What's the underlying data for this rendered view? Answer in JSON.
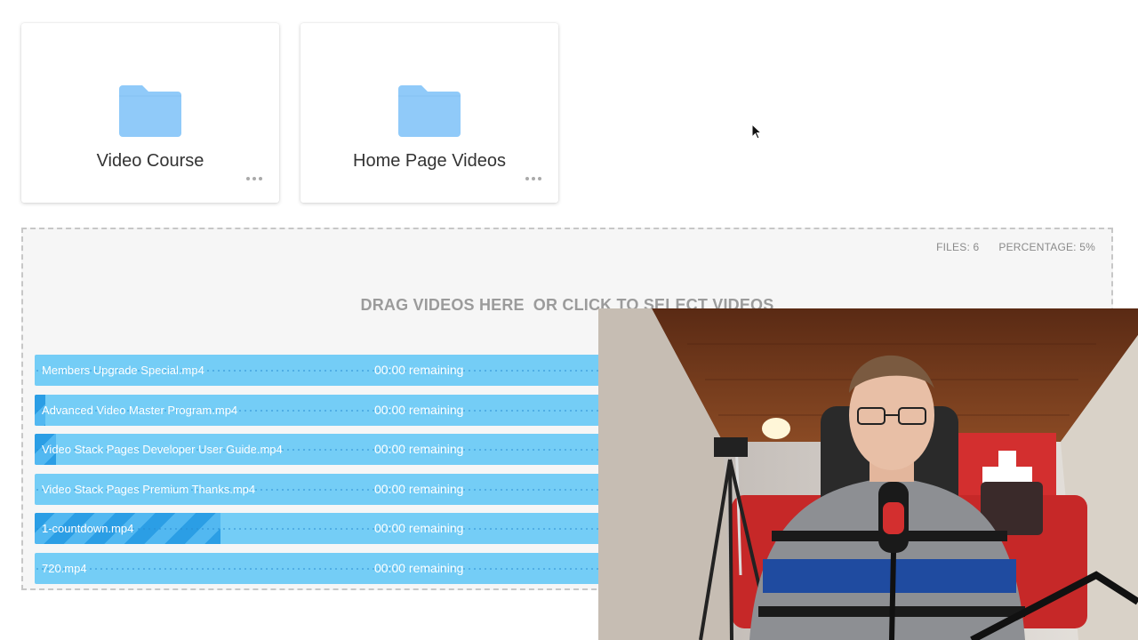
{
  "folders": [
    {
      "name": "Video Course"
    },
    {
      "name": "Home Page Videos"
    }
  ],
  "dropzone": {
    "files_label": "FILES: 6",
    "percentage_label": "PERCENTAGE: 5%",
    "drag_text": "DRAG VIDEOS HERE",
    "click_text": "OR CLICK TO SELECT VIDEOS"
  },
  "uploads": [
    {
      "name": "Members Upgrade Special.mp4",
      "remaining": "00:00 remaining",
      "progress": 0.0
    },
    {
      "name": "Advanced Video Master Program.mp4",
      "remaining": "00:00 remaining",
      "progress": 0.01
    },
    {
      "name": "Video Stack Pages Developer User Guide.mp4",
      "remaining": "00:00 remaining",
      "progress": 0.02
    },
    {
      "name": "Video Stack Pages Premium Thanks.mp4",
      "remaining": "00:00 remaining",
      "progress": 0.0
    },
    {
      "name": "1-countdown.mp4",
      "remaining": "00:00 remaining",
      "progress": 0.175
    },
    {
      "name": "720.mp4",
      "remaining": "00:00 remaining",
      "progress": 0.0
    }
  ],
  "colors": {
    "folder": "#90caf9",
    "row_bg": "#74cdf6",
    "row_progress": "#2b9ee5"
  },
  "icons": {
    "folder": "folder-icon",
    "menu": "more-horizontal-icon",
    "cursor": "mouse-cursor-icon"
  }
}
